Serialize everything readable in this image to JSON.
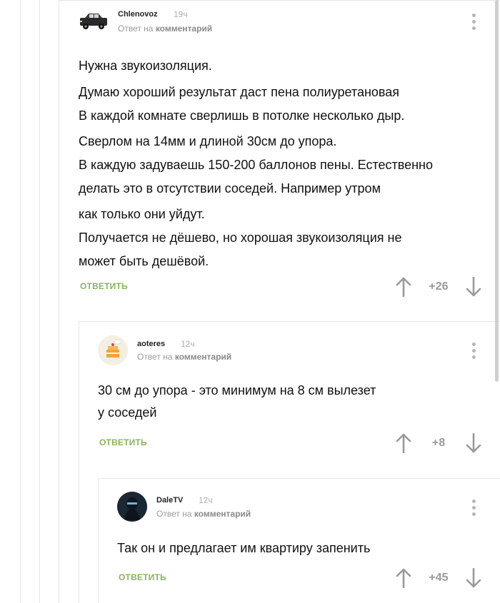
{
  "comments": [
    {
      "author": "Chlenovoz",
      "time": "19ч",
      "reply_prefix": "Ответ на",
      "reply_target": "комментарий",
      "avatar_icon": "car-avatar",
      "body": [
        "Нужна звукоизоляция.",
        "Думаю хороший результат даст пена полиуретановая",
        "В каждой комнате сверлишь в потолке несколько дыр.",
        "Сверлом на 14мм и длиной 30см до упора.",
        "В каждую задуваешь 150-200 баллонов пены. Естественно",
        "делать это в отсутствии соседей. Например утром",
        "как только они уйдут.",
        "Получается не дёшево, но хорошая звукоизоляция не",
        "может быть дешёвой."
      ],
      "answer_label": "ОТВЕТИТЬ",
      "score": "+26"
    },
    {
      "author": "aoteres",
      "time": "12ч",
      "reply_prefix": "Ответ на",
      "reply_target": "комментарий",
      "avatar_icon": "cake-avatar",
      "body": [
        "30 см до упора - это минимум на 8 см вылезет",
        "у соседей"
      ],
      "answer_label": "ОТВЕТИТЬ",
      "score": "+8"
    },
    {
      "author": "DaleTV",
      "time": "12ч",
      "reply_prefix": "Ответ на",
      "reply_target": "комментарий",
      "avatar_icon": "ninja-avatar",
      "body": [
        "Так он и предлагает им квартиру запенить"
      ],
      "answer_label": "ОТВЕТИТЬ",
      "score": "+45"
    }
  ],
  "colors": {
    "accent_green": "#8ab55a",
    "muted_gray": "#9a9a9a",
    "thread_line": "#e6e6e6"
  }
}
